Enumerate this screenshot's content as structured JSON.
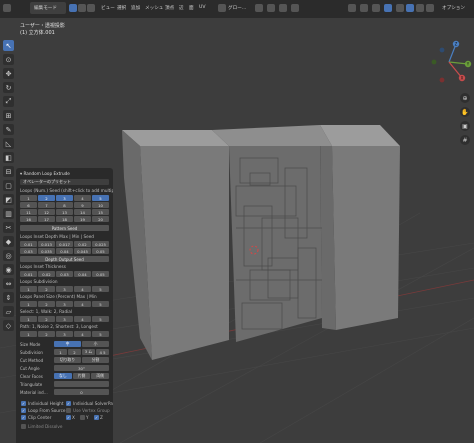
{
  "header": {
    "mode": "編集モード",
    "menu": [
      "ビュー",
      "選択",
      "追加",
      "メッシュ",
      "頂点",
      "辺",
      "面",
      "UV"
    ],
    "transform_orientation": "グロー…",
    "options": "オプション"
  },
  "overlay": {
    "view_name": "ユーザー・透視投影",
    "object_name": "(1) 立方体.001"
  },
  "gizmo": {
    "axes": [
      "Z",
      "Y",
      "X"
    ]
  },
  "panel": {
    "title": "Random Loop Extrude",
    "preset": "オペレーターのプリセット",
    "loops_label": "Loops (Num.) Seed (shift+click to add multiple v…",
    "loops_grid": [
      [
        "1",
        "2",
        "3",
        "4",
        "5"
      ],
      [
        "6",
        "7",
        "8",
        "9",
        "10"
      ],
      [
        "11",
        "12",
        "13",
        "14",
        "15"
      ],
      [
        "16",
        "17",
        "18",
        "19",
        "20"
      ]
    ],
    "loops_highlight": [
      1,
      2,
      4,
      5
    ],
    "pattern_seed": "Pattern Seed",
    "depth_label": "Loops Inset Depth Max | Min | Seed",
    "depth_values": [
      "0.01",
      "0.013",
      "0.017",
      "0.02",
      "0.025"
    ],
    "depth_values2": [
      "0.03",
      "0.035",
      "0.04",
      "0.045",
      "0.05"
    ],
    "depth_seed": "Depth Output Seed",
    "thickness_label": "Loops Inset Thickness",
    "thickness_values": [
      "0.01",
      "0.02",
      "0.03",
      "0.04",
      "0.05"
    ],
    "subdiv_label": "Loops Subdivision",
    "subdiv_values": [
      "1",
      "2",
      "3",
      "4",
      "5"
    ],
    "panel_size_label": "Loops Panel Size (Percent) Max | Min",
    "panel_size_values": [
      "1",
      "2",
      "3",
      "4",
      "5"
    ],
    "sel_label": "Select: 1, Walk: 2, Radial",
    "sel_values": [
      "1",
      "2",
      "3",
      "4",
      "5"
    ],
    "path_label": "Path: 1, Noise 2, Shortest: 3, Longest",
    "path_values": [
      "1",
      "2",
      "3",
      "4",
      "5"
    ],
    "rows": [
      {
        "label": "Size Mode",
        "values": [
          "中",
          "小"
        ],
        "hl": 0
      },
      {
        "label": "Subdivision",
        "values": [
          "1",
          "2",
          "3 ム",
          "4 5"
        ],
        "hl": -1
      },
      {
        "label": "Cut Method",
        "values": [
          "切り取り",
          "分割"
        ],
        "hl": -1
      },
      {
        "label": "Cut Angle",
        "values": [
          "30°"
        ],
        "hl": -1
      },
      {
        "label": "Clear Faces",
        "values": [
          "なし",
          "片側",
          "両側"
        ],
        "hl": 0
      },
      {
        "label": "Triangulate",
        "values": [
          ""
        ],
        "hl": -1
      },
      {
        "label": "Material ind…",
        "values": [
          "0"
        ],
        "hl": -1
      }
    ],
    "checks": [
      {
        "label": "Individual Height",
        "on": true
      },
      {
        "label": "Individual SolverPath",
        "on": true
      },
      {
        "label": "Loop From Source",
        "on": true
      },
      {
        "label": "Use Vertex Group",
        "on": false
      },
      {
        "label": "Clip Center",
        "on": true
      },
      {
        "label": "X",
        "on": true
      },
      {
        "label": "Y",
        "on": false
      },
      {
        "label": "Z",
        "on": true
      },
      {
        "label": "Limited Dissolve",
        "on": false
      }
    ]
  },
  "colors": {
    "accent": "#4772b3",
    "panel": "#2a2a2a",
    "field": "#545454",
    "bg": "#3d3d3d"
  }
}
